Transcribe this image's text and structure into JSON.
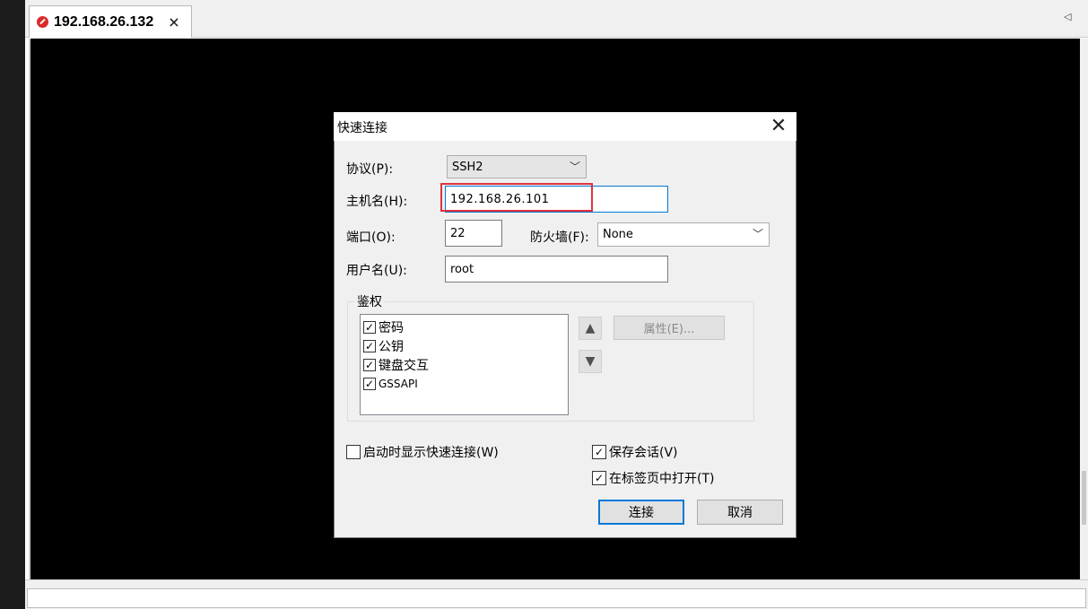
{
  "tab": {
    "title": "192.168.26.132",
    "close": "×"
  },
  "dialog": {
    "title": "快速连接",
    "close": "✕",
    "protocol": {
      "label": "协议(P):",
      "value": "SSH2"
    },
    "hostname": {
      "label": "主机名(H):",
      "value": "192.168.26.101"
    },
    "port": {
      "label": "端口(O):",
      "value": "22"
    },
    "firewall": {
      "label": "防火墙(F):",
      "value": "None"
    },
    "username": {
      "label": "用户名(U):",
      "value": "root"
    },
    "auth": {
      "group_label": "鉴权",
      "items": [
        {
          "label": "密码",
          "checked": true
        },
        {
          "label": "公钥",
          "checked": true
        },
        {
          "label": "键盘交互",
          "checked": true
        },
        {
          "label": "GSSAPI",
          "checked": true
        }
      ],
      "properties_button": "属性(E)..."
    },
    "show_on_startup": {
      "label": "启动时显示快速连接(W)",
      "checked": false
    },
    "save_session": {
      "label": "保存会话(V)",
      "checked": true
    },
    "open_in_tab": {
      "label": "在标签页中打开(T)",
      "checked": true
    },
    "connect_button": "连接",
    "cancel_button": "取消"
  },
  "colors": {
    "terminal_bg": "#000000",
    "highlight": "#e0333b",
    "focus_blue": "#0078d7",
    "tab_icon": "#d92b2b"
  },
  "icons": [
    "session-icon",
    "close-icon",
    "scroll-left-icon",
    "chevron-down-icon",
    "arrow-up-icon",
    "arrow-down-icon",
    "checkbox-checked-icon"
  ]
}
